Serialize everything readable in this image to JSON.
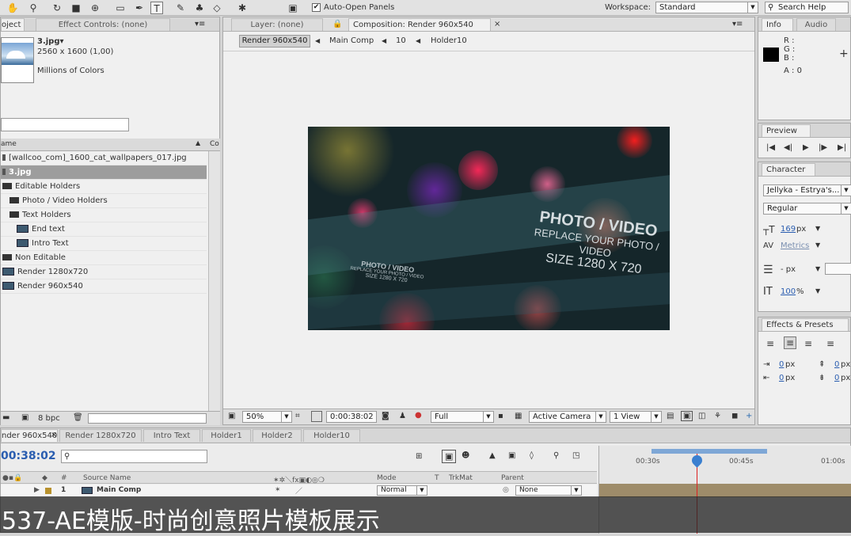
{
  "toolbar": {
    "auto_open_label": "Auto-Open Panels",
    "auto_open_checked": "✔",
    "workspace_label": "Workspace:",
    "workspace_value": "Standard",
    "search_placeholder": "Search Help"
  },
  "project_panel": {
    "tab_project": "oject",
    "tab_effect": "Effect Controls: (none)",
    "file_name": "3.jpg▾",
    "file_dims": "2560 x 1600 (1,00)",
    "file_colors": "Millions of Colors",
    "col_name": "ame",
    "col_comment": "Co",
    "bpc_label": "8 bpc",
    "items": [
      {
        "label": "[wallcoo_com]_1600_cat_wallpapers_017.jpg",
        "indent": 0,
        "icon": "image"
      },
      {
        "label": "3.jpg",
        "indent": 0,
        "icon": "image",
        "selected": true
      },
      {
        "label": "Editable Holders",
        "indent": 0,
        "icon": "folder"
      },
      {
        "label": "Photo / Video Holders",
        "indent": 1,
        "icon": "folder"
      },
      {
        "label": "Text Holders",
        "indent": 1,
        "icon": "folder"
      },
      {
        "label": "End text",
        "indent": 2,
        "icon": "comp"
      },
      {
        "label": "Intro Text",
        "indent": 2,
        "icon": "comp"
      },
      {
        "label": "Non Editable",
        "indent": 0,
        "icon": "folder"
      },
      {
        "label": "Render 1280x720",
        "indent": 0,
        "icon": "comp"
      },
      {
        "label": "Render 960x540",
        "indent": 0,
        "icon": "comp"
      }
    ]
  },
  "viewer": {
    "tab_layer": "Layer: (none)",
    "tab_comp": "Composition: Render 960x540",
    "breadcrumbs": [
      "Render 960x540",
      "Main Comp",
      "10",
      "Holder10"
    ],
    "overlay_big": [
      "PHOTO / VIDEO",
      "REPLACE YOUR PHOTO / VIDEO",
      "SIZE 1280 X 720"
    ],
    "overlay_small": [
      "PHOTO / VIDEO",
      "REPLACE YOUR PHOTO / VIDEO",
      "SIZE 1280 X 720"
    ],
    "zoom": "50%",
    "timecode": "0:00:38:02",
    "resolution": "Full",
    "camera": "Active Camera",
    "views": "1 View"
  },
  "info_panel": {
    "tab_info": "Info",
    "tab_audio": "Audio",
    "r": "R :",
    "g": "G :",
    "b": "B :",
    "a": "A : 0"
  },
  "preview_panel": {
    "tab": "Preview"
  },
  "character_panel": {
    "tab": "Character",
    "font": "Jellyka - Estrya's...",
    "style": "Regular",
    "size": "169",
    "size_unit": "px",
    "kerning": "Metrics",
    "leading": "- px",
    "scale": "100",
    "scale_unit": "%"
  },
  "effects_panel": {
    "tab": "Effects & Presets",
    "indent_left": "0",
    "indent_right": "0",
    "space_before": "0",
    "space_after": "0",
    "px": "px"
  },
  "timeline": {
    "tabs": [
      "nder 960x540",
      "Render 1280x720",
      "Intro Text",
      "Holder1",
      "Holder2",
      "Holder10"
    ],
    "timecode": "00:38:02",
    "col_source": "Source Name",
    "col_mode": "Mode",
    "col_t": "T",
    "col_trkmat": "TrkMat",
    "col_parent": "Parent",
    "layer_num": "1",
    "layer_name": "Main Comp",
    "layer_mode": "Normal",
    "layer_parent": "None",
    "ruler": [
      "00:30s",
      "00:45s",
      "01:00s"
    ]
  },
  "subtitle": "537-AE模版-时尚创意照片模板展示"
}
